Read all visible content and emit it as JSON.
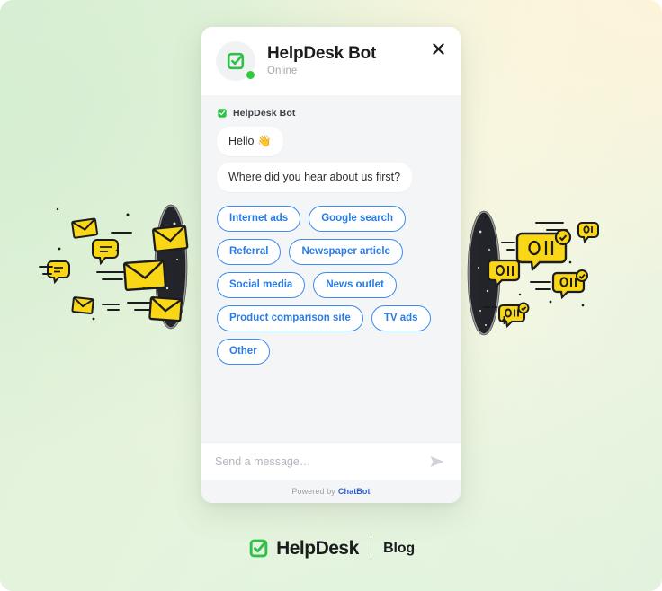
{
  "page": {
    "background_left": "#dcf0d8",
    "background_right": "#fdf4da"
  },
  "widget": {
    "header": {
      "avatar_icon": "helpdesk-check-square-icon",
      "title": "HelpDesk Bot",
      "status": "Online",
      "status_color": "#2fcc39",
      "close_icon": "close-icon"
    },
    "conversation": {
      "author_icon": "helpdesk-check-square-icon",
      "author_name": "HelpDesk Bot",
      "messages": [
        {
          "text": "Hello 👋"
        },
        {
          "text": "Where did you hear about us first?"
        }
      ],
      "quick_replies": [
        "Internet ads",
        "Google search",
        "Referral",
        "Newspaper article",
        "Social media",
        "News outlet",
        "Product comparison site",
        "TV ads",
        "Other"
      ],
      "quick_reply_color": "#2a7be4"
    },
    "composer": {
      "placeholder": "Send a message…",
      "value": "",
      "send_icon": "send-paper-plane-icon"
    },
    "footer": {
      "powered_text": "Powered by",
      "brand": "ChatBot",
      "brand_color": "#2b5fd9"
    }
  },
  "brand_bar": {
    "logo_icon": "helpdesk-check-square-icon",
    "name": "HelpDesk",
    "blog_label": "Blog"
  },
  "illustrations": {
    "left": "envelopes-flying-into-portal",
    "right": "chat-bubbles-exiting-portal"
  }
}
